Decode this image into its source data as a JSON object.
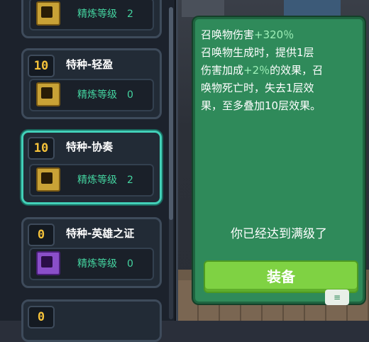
{
  "list": {
    "cards": [
      {
        "level": "",
        "title": "",
        "refine_label": "精炼等级",
        "refine_value": "2",
        "icon": "gold-trophy-icon"
      },
      {
        "level": "10",
        "title": "特种-轻盈",
        "refine_label": "精炼等级",
        "refine_value": "0",
        "icon": "gold-trophy-icon"
      },
      {
        "level": "10",
        "title": "特种-协奏",
        "refine_label": "精炼等级",
        "refine_value": "2",
        "icon": "gold-trophy-icon"
      },
      {
        "level": "0",
        "title": "特种-英雄之证",
        "refine_label": "精炼等级",
        "refine_value": "0",
        "icon": "purple-trophy-icon"
      },
      {
        "level": "0",
        "title": "",
        "refine_label": "",
        "refine_value": "",
        "icon": ""
      }
    ]
  },
  "detail": {
    "line1_text": "召唤物伤害",
    "line1_value": "+320％",
    "line2": "召唤物生成时，提供1层",
    "line3_pre": "伤害加成",
    "line3_value": "+2％",
    "line3_post": "的效果，召",
    "line4": "唤物死亡时，失去1层效",
    "line5": "果，至多叠加10层效果。",
    "maxed_text": "你已经达到满级了",
    "equip_label": "装备",
    "chat_label": "≡"
  },
  "colors": {
    "accent": "#42d0b8",
    "level": "#f5c23a",
    "refine": "#44d4a0",
    "panel": "#2f8a5a",
    "button": "#7fd243"
  }
}
